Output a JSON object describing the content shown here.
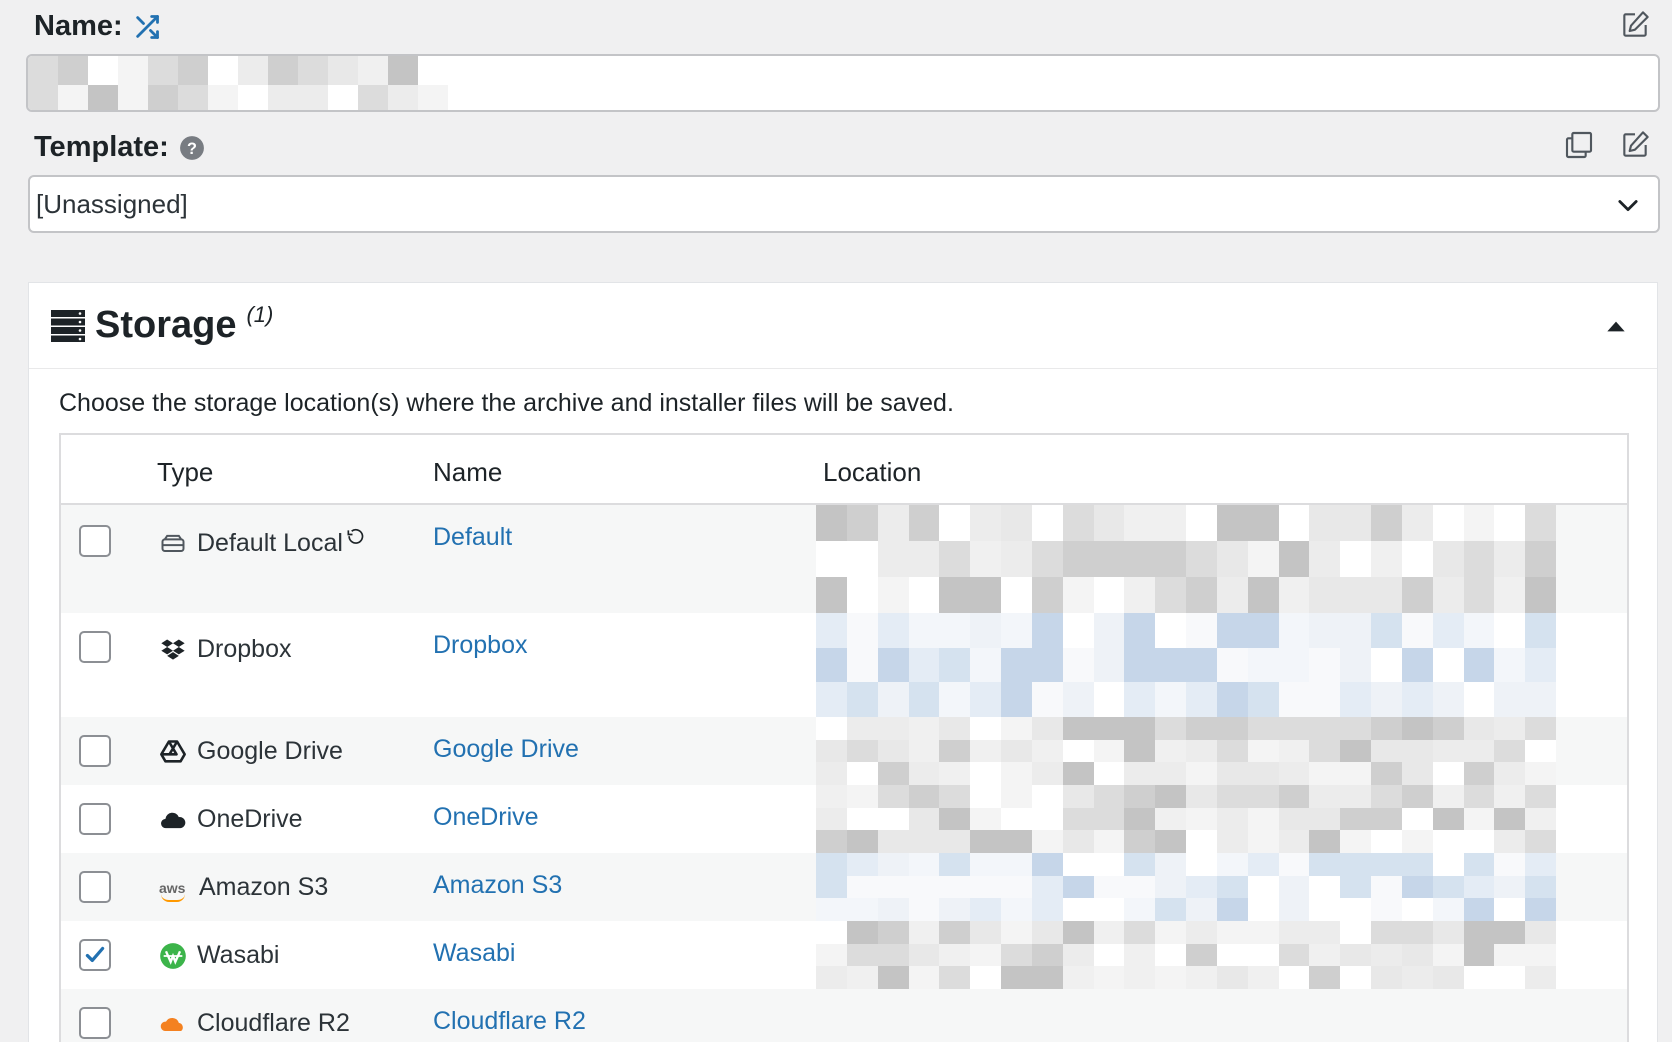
{
  "name_field": {
    "label": "Name:",
    "value": ""
  },
  "template_field": {
    "label": "Template:",
    "selected": "[Unassigned]"
  },
  "storage": {
    "title": "Storage",
    "count": "(1)",
    "description": "Choose the storage location(s) where the archive and installer files will be saved.",
    "columns": {
      "type": "Type",
      "name": "Name",
      "location": "Location"
    },
    "rows": [
      {
        "type": "Default Local",
        "icon": "hard-drive-icon",
        "name": "Default",
        "checked": false
      },
      {
        "type": "Dropbox",
        "icon": "dropbox-icon",
        "name": "Dropbox",
        "checked": false
      },
      {
        "type": "Google Drive",
        "icon": "google-drive-icon",
        "name": "Google Drive",
        "checked": false
      },
      {
        "type": "OneDrive",
        "icon": "onedrive-cloud-icon",
        "name": "OneDrive",
        "checked": false
      },
      {
        "type": "Amazon S3",
        "icon": "aws-icon",
        "name": "Amazon S3",
        "checked": false
      },
      {
        "type": "Wasabi",
        "icon": "wasabi-icon",
        "name": "Wasabi",
        "checked": true
      },
      {
        "type": "Cloudflare R2",
        "icon": "cloudflare-icon",
        "name": "Cloudflare R2",
        "checked": false
      }
    ]
  },
  "colors": {
    "link": "#2271b1",
    "check": "#2271b1",
    "wasabi": "#3cb44a"
  }
}
